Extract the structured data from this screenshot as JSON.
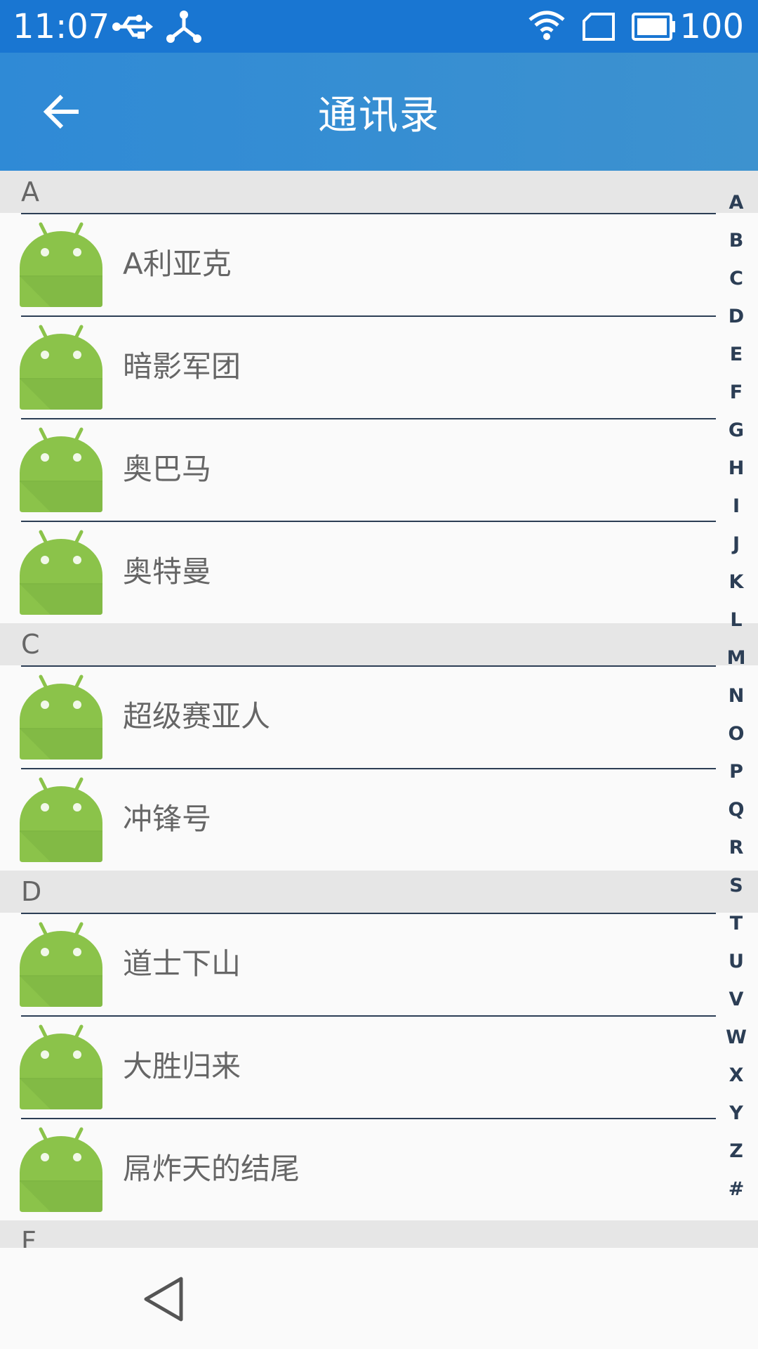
{
  "status_bar": {
    "time": "11:07",
    "battery": "100",
    "icons": [
      "usb-icon",
      "share-network-icon",
      "wifi-icon",
      "sim-card-icon",
      "battery-icon"
    ],
    "background": "#1976d2"
  },
  "app_bar": {
    "title": "通讯录",
    "back_icon": "arrow-left-icon",
    "background": "#3a8fd3"
  },
  "sections": [
    {
      "letter": "A",
      "contacts": [
        "A利亚克",
        "暗影军团",
        "奥巴马",
        "奥特曼"
      ]
    },
    {
      "letter": "C",
      "contacts": [
        "超级赛亚人",
        "冲锋号"
      ]
    },
    {
      "letter": "D",
      "contacts": [
        "道士下山",
        "大胜归来",
        "屌炸天的结尾"
      ]
    },
    {
      "letter": "F",
      "contacts": []
    }
  ],
  "index_letters": [
    "A",
    "B",
    "C",
    "D",
    "E",
    "F",
    "G",
    "H",
    "I",
    "J",
    "K",
    "L",
    "M",
    "N",
    "O",
    "P",
    "Q",
    "R",
    "S",
    "T",
    "U",
    "V",
    "W",
    "X",
    "Y",
    "Z",
    "#"
  ],
  "avatar_icon": "android-avatar-icon",
  "nav_bar": {
    "back_icon": "triangle-back-icon"
  }
}
